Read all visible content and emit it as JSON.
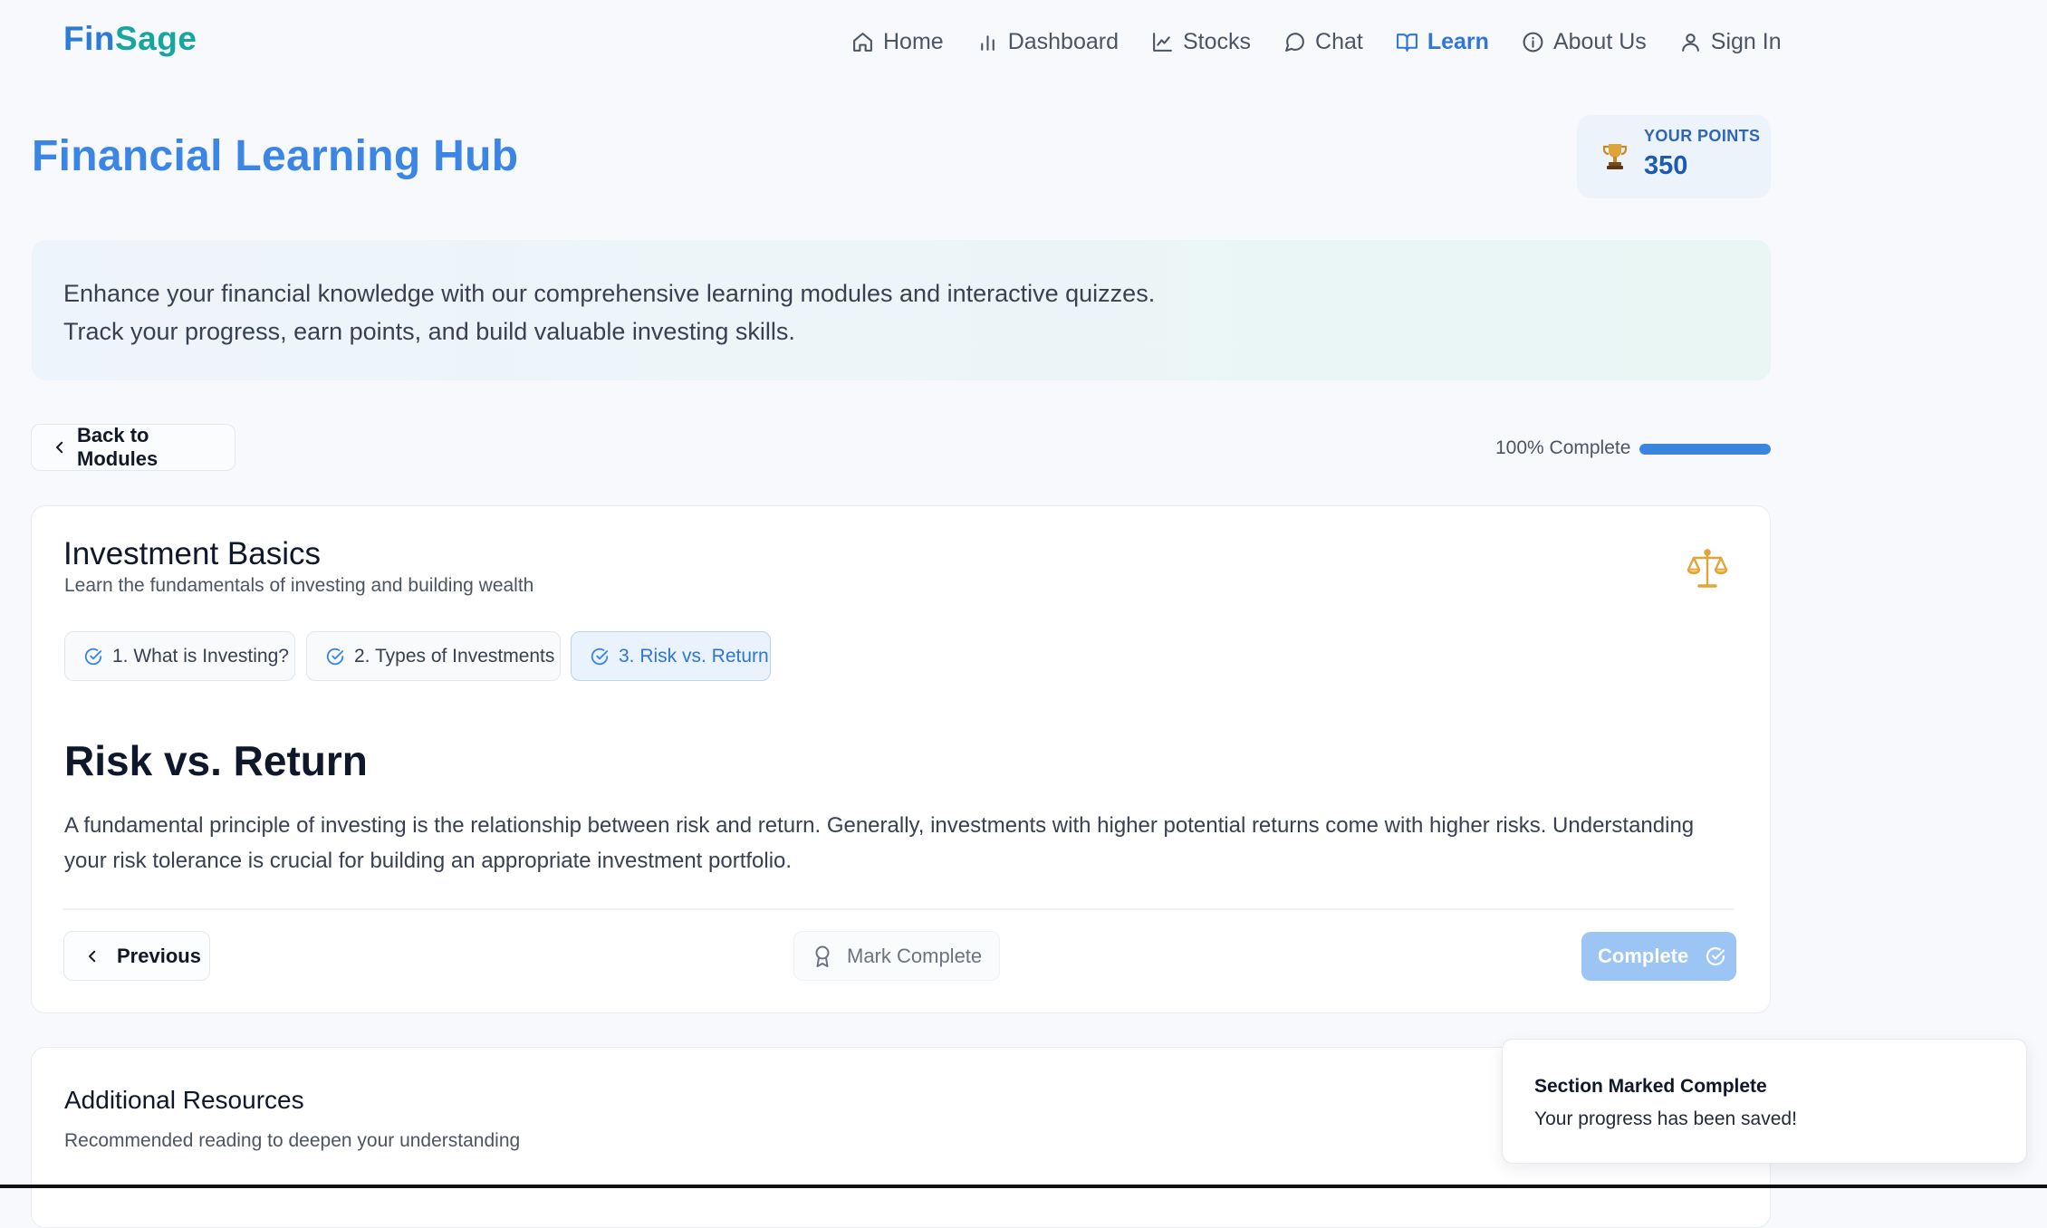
{
  "app": {
    "logo_part1": "Fin",
    "logo_part2": "Sage"
  },
  "nav": {
    "items": [
      {
        "label": "Home",
        "icon": "home-icon",
        "active": false
      },
      {
        "label": "Dashboard",
        "icon": "bar-chart-icon",
        "active": false
      },
      {
        "label": "Stocks",
        "icon": "line-chart-icon",
        "active": false
      },
      {
        "label": "Chat",
        "icon": "chat-bubble-icon",
        "active": false
      },
      {
        "label": "Learn",
        "icon": "book-open-icon",
        "active": true
      },
      {
        "label": "About Us",
        "icon": "info-icon",
        "active": false
      },
      {
        "label": "Sign In",
        "icon": "user-icon",
        "active": false
      }
    ]
  },
  "header": {
    "title": "Financial Learning Hub",
    "points_label": "YOUR POINTS",
    "points_value": "350"
  },
  "intro": {
    "text": "Enhance your financial knowledge with our comprehensive learning modules and interactive quizzes. Track your progress, earn points, and build valuable investing skills."
  },
  "progress": {
    "back_label": "Back to Modules",
    "text": "100% Complete",
    "fraction": 1.0
  },
  "module": {
    "title": "Investment Basics",
    "subtitle": "Learn the fundamentals of investing and building wealth",
    "sections": [
      {
        "label": "1. What is Investing?",
        "completed": true,
        "active": false
      },
      {
        "label": "2. Types of Investments",
        "completed": true,
        "active": false
      },
      {
        "label": "3. Risk vs. Return",
        "completed": true,
        "active": true
      }
    ],
    "section_title": "Risk vs. Return",
    "section_body": "A fundamental principle of investing is the relationship between risk and return. Generally, investments with higher potential returns come with higher risks. Understanding your risk tolerance is crucial for building an appropriate investment portfolio.",
    "previous_label": "Previous",
    "mark_complete_label": "Mark Complete",
    "complete_label": "Complete"
  },
  "resources": {
    "title": "Additional Resources",
    "subtitle": "Recommended reading to deepen your understanding"
  },
  "toast": {
    "title": "Section Marked Complete",
    "message": "Your progress has been saved!"
  },
  "colors": {
    "accent": "#3b86e4",
    "logo_blue": "#2b7bd8",
    "logo_teal": "#16a5a0",
    "complete_button": "#9cc4f4"
  }
}
